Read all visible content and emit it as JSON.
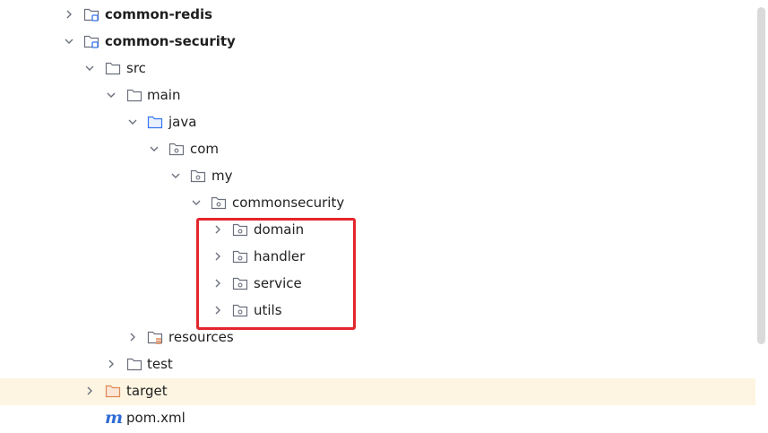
{
  "project_tree": {
    "rows": [
      {
        "label": "common-redis",
        "icon": "module-folder-icon",
        "expanded": false,
        "bold": true
      },
      {
        "label": "common-security",
        "icon": "module-folder-icon",
        "expanded": true,
        "bold": true
      },
      {
        "label": "src",
        "icon": "folder-icon",
        "expanded": true
      },
      {
        "label": "main",
        "icon": "folder-icon",
        "expanded": true
      },
      {
        "label": "java",
        "icon": "source-root-folder-icon",
        "expanded": true
      },
      {
        "label": "com",
        "icon": "package-icon",
        "expanded": true
      },
      {
        "label": "my",
        "icon": "package-icon",
        "expanded": true
      },
      {
        "label": "commonsecurity",
        "icon": "package-icon",
        "expanded": true
      },
      {
        "label": "domain",
        "icon": "package-icon",
        "expanded": false
      },
      {
        "label": "handler",
        "icon": "package-icon",
        "expanded": false
      },
      {
        "label": "service",
        "icon": "package-icon",
        "expanded": false
      },
      {
        "label": "utils",
        "icon": "package-icon",
        "expanded": false
      },
      {
        "label": "resources",
        "icon": "resources-folder-icon",
        "expanded": false
      },
      {
        "label": "test",
        "icon": "folder-icon",
        "expanded": false
      },
      {
        "label": "target",
        "icon": "excluded-folder-icon",
        "expanded": false,
        "selected": true
      },
      {
        "label": "pom.xml",
        "icon": "maven-pom-icon",
        "expanded": null
      }
    ]
  },
  "colors": {
    "selection_background": "#fdf5e2",
    "highlight_box": "#e2262b",
    "folder_outline": "#6c707e",
    "source_root": "#3574f0",
    "excluded_folder": "#e08855",
    "maven_icon": "#2f6bd6"
  }
}
